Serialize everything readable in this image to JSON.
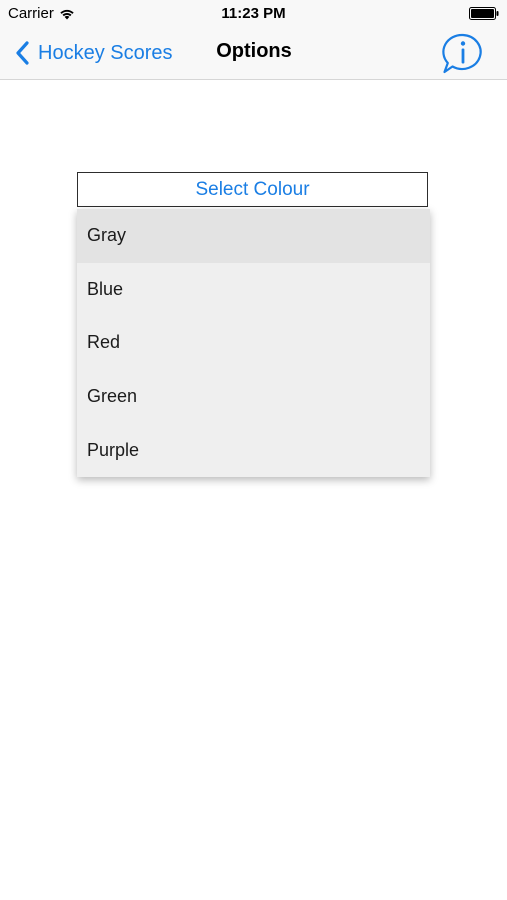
{
  "status_bar": {
    "carrier": "Carrier",
    "time": "11:23 PM"
  },
  "nav": {
    "back_label": "Hockey Scores",
    "title": "Options"
  },
  "select": {
    "label": "Select Colour",
    "options": [
      "Gray",
      "Blue",
      "Red",
      "Green",
      "Purple"
    ],
    "highlighted": "Gray"
  },
  "colors": {
    "accent": "#1a7ee4",
    "dropdown_bg": "#efefef",
    "highlight_bg": "#e3e3e3"
  }
}
